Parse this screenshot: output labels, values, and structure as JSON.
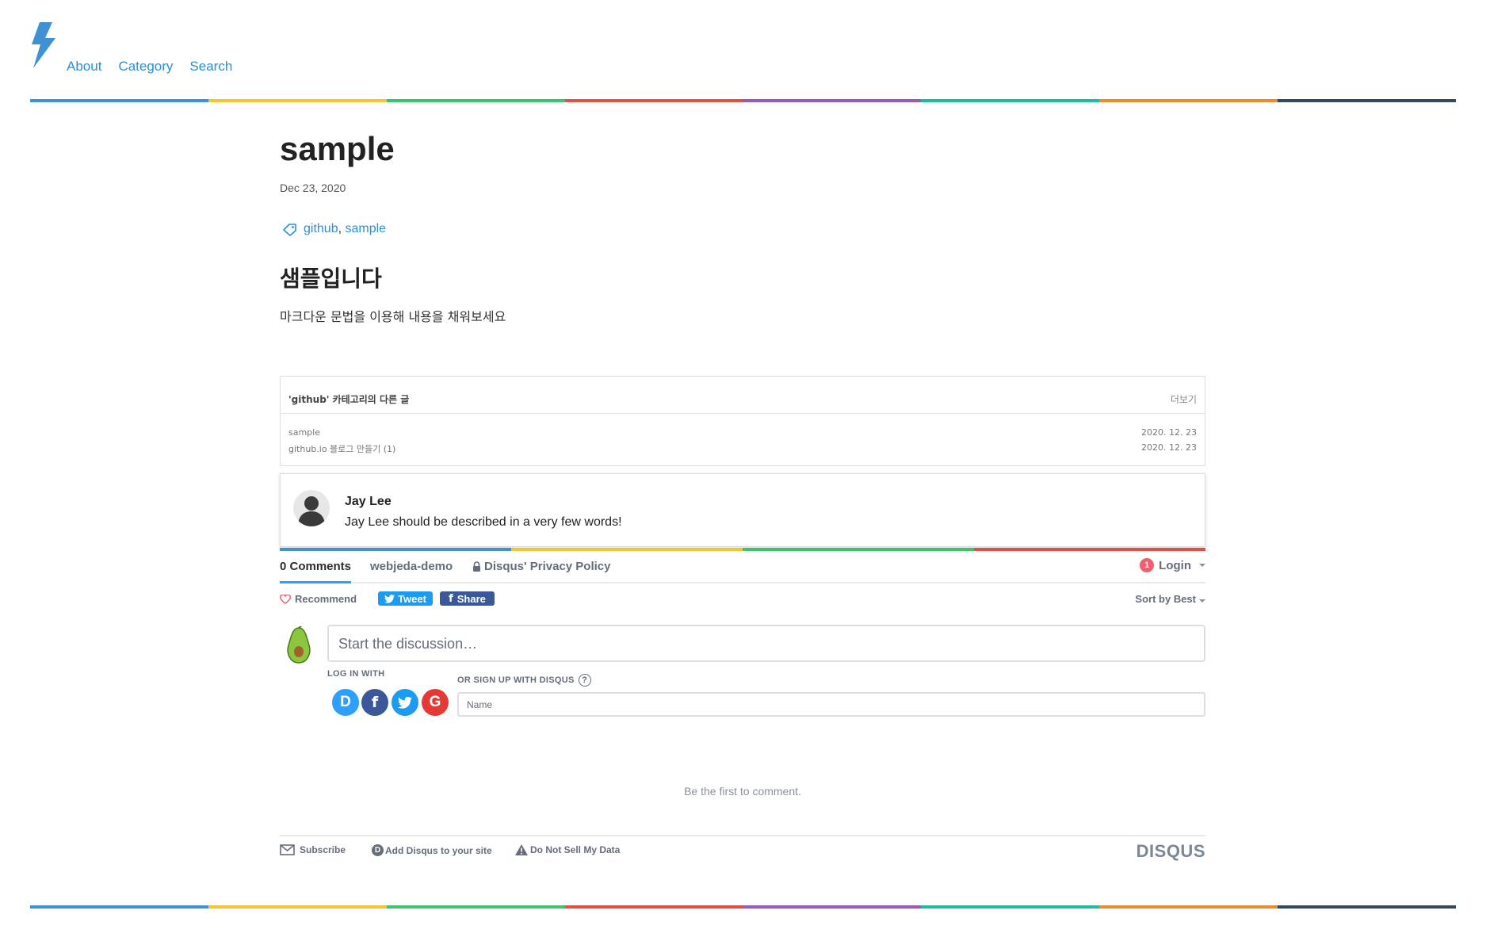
{
  "header": {
    "logo_icon": "lightning-bolt-icon",
    "nav": [
      "About",
      "Category",
      "Search"
    ]
  },
  "colors": {
    "rainbow": [
      "#3f91d3",
      "#f4c531",
      "#3ec36d",
      "#e34f42",
      "#9b59b6",
      "#1fbc9c",
      "#eb8a2f",
      "#34495e"
    ],
    "link": "#2a8fd6"
  },
  "post": {
    "title": "sample",
    "date": "Dec 23, 2020",
    "tags": [
      "github",
      "sample"
    ],
    "heading": "샘플입니다",
    "body": "마크다운 문법을 이용해 내용을 채워보세요"
  },
  "related": {
    "title": "'github' 카테고리의 다른 글",
    "more": "더보기",
    "items": [
      {
        "title": "sample",
        "date": "2020. 12. 23"
      },
      {
        "title": "github.io 블로그 만들기 (1)",
        "date": "2020. 12. 23"
      }
    ]
  },
  "author": {
    "name": "Jay Lee",
    "description": "Jay Lee should be described in a very few words!"
  },
  "disqus": {
    "tabs": {
      "comments": "0 Comments",
      "site": "webjeda-demo",
      "privacy": "Disqus' Privacy Policy"
    },
    "login": {
      "badge": "1",
      "label": "Login"
    },
    "recommend": "Recommend",
    "tweet": "Tweet",
    "share": "Share",
    "sort": "Sort by Best",
    "input_placeholder": "Start the discussion…",
    "log_in_with": "LOG IN WITH",
    "or_sign_up": "OR SIGN UP WITH DISQUS",
    "question_mark": "?",
    "social": {
      "disqus": "D",
      "facebook": "f",
      "google": "G"
    },
    "name_placeholder": "Name",
    "first_comment": "Be the first to comment.",
    "footer": {
      "subscribe": "Subscribe",
      "add": "Add Disqus to your site",
      "dnsmd": "Do Not Sell My Data",
      "logo": "DISQUS"
    }
  }
}
